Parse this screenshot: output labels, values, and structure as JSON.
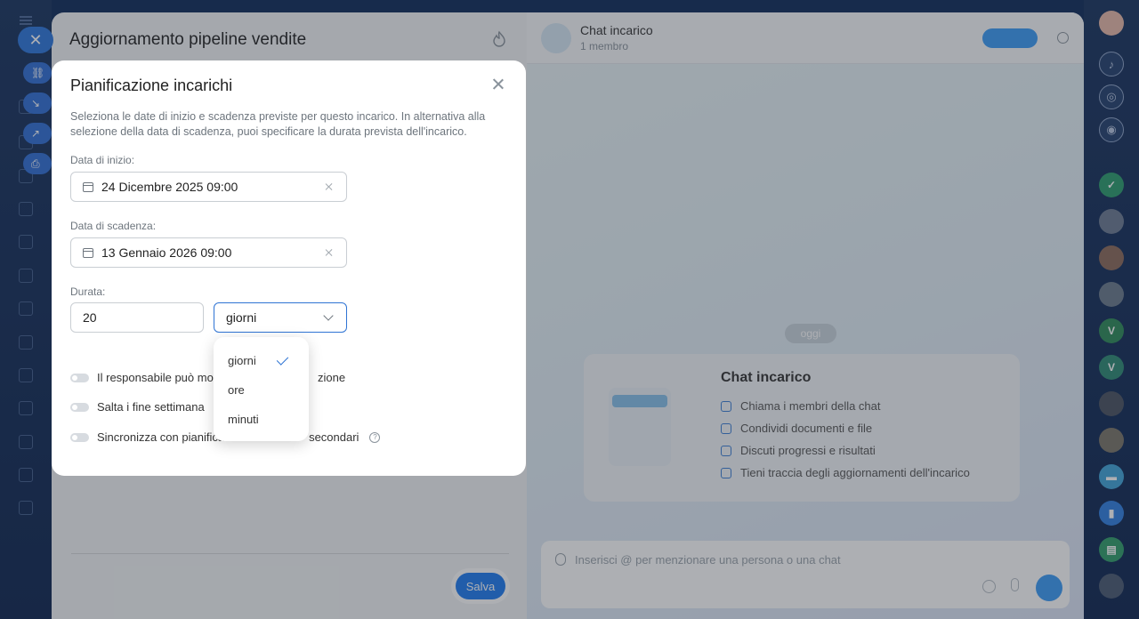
{
  "task": {
    "title": "Aggiornamento pipeline vendite",
    "save_label": "Salva"
  },
  "chat": {
    "title": "Chat incarico",
    "subtitle": "1 membro",
    "today_label": "oggi",
    "card_title": "Chat incarico",
    "card_items": [
      "Chiama i membri della chat",
      "Condividi documenti e file",
      "Discuti progressi e risultati",
      "Tieni traccia degli aggiornamenti dell'incarico"
    ],
    "composer_placeholder": "Inserisci @ per menzionare una persona o una chat"
  },
  "dialog": {
    "title": "Pianificazione incarichi",
    "description": "Seleziona le date di inizio e scadenza previste per questo incarico. In alternativa alla selezione della data di scadenza, puoi specificare la durata prevista dell'incarico.",
    "start_label": "Data di inizio:",
    "start_value": "24 Dicembre 2025 09:00",
    "due_label": "Data di scadenza:",
    "due_value": "13 Gennaio 2026 09:00",
    "duration_label": "Durata:",
    "duration_value": "20",
    "unit_value": "giorni",
    "toggles": [
      {
        "label": "Il responsabile può mod",
        "label_tail": "zione"
      },
      {
        "label": "Salta i fine settimana"
      },
      {
        "label": "Sincronizza con pianifica",
        "label_tail": "secondari"
      }
    ]
  },
  "dropdown": {
    "options": [
      "giorni",
      "ore",
      "minuti"
    ],
    "selected": "giorni"
  },
  "right_rail": {
    "avatars": [
      "V",
      "V"
    ]
  },
  "colors": {
    "accent": "#2f74d4",
    "save": "#1e7bf0",
    "rail": "#17325e"
  }
}
